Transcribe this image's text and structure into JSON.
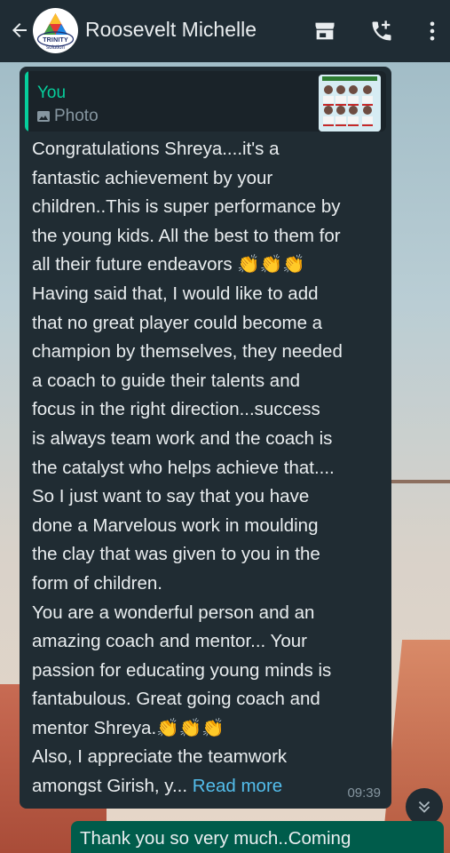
{
  "header": {
    "contact_name": "Roosevelt Michelle",
    "avatar_text": "TRINITY",
    "avatar_subtext": "solution",
    "icons": [
      "back-arrow-icon",
      "shop-icon",
      "add-call-icon",
      "more-vert-icon"
    ]
  },
  "message": {
    "quote_author": "You",
    "quote_kind": "Photo",
    "lines": [
      "Congratulations Shreya....it's a",
      "fantastic achievement by your",
      "children..This is super performance by",
      "the young kids. All the best to them for",
      "all their future endeavors 👏👏👏",
      "Having said that, I would like to add",
      "that no great player could become a",
      "champion by themselves, they needed",
      "a coach to guide their talents and",
      "focus in the right direction...success",
      "is always team work and the coach is",
      "the catalyst who helps achieve that....",
      "So I just want to say that you have",
      "done a Marvelous work in moulding",
      "the clay that was given to you in the",
      "form of children.",
      "You are a wonderful person and an",
      "amazing coach and mentor... Your",
      "passion for educating young minds is",
      "fantabulous. Great going coach and",
      "mentor Shreya.👏👏👏",
      "Also, I appreciate the teamwork"
    ],
    "last_line": "amongst Girish, y... ",
    "read_more": "Read more",
    "time": "09:39"
  },
  "outgoing": {
    "text": "Thank you so very much..Coming"
  },
  "colors": {
    "header_bg": "#1f2c34",
    "bubble_in": "#202c33",
    "bubble_out": "#005c4b",
    "accent": "#06cf9c",
    "link": "#53bdeb"
  }
}
